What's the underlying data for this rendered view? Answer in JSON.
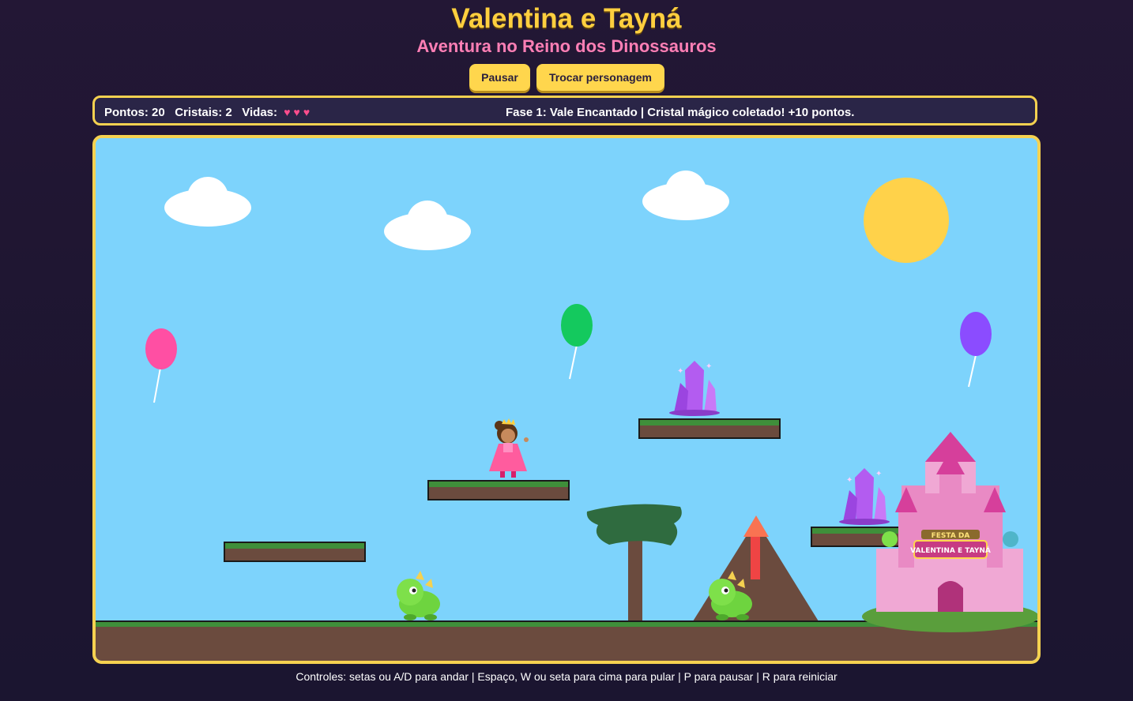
{
  "header": {
    "title": "Valentina e Tayná",
    "subtitle": "Aventura no Reino dos Dinossauros"
  },
  "controls": {
    "pause_label": "Pausar",
    "switch_character_label": "Trocar personagem"
  },
  "hud": {
    "points_label": "Pontos:",
    "points": "20",
    "crystals_label": "Cristais:",
    "crystals": "2",
    "lives_label": "Vidas:",
    "lives_count": 3,
    "status_message": "Fase 1: Vale Encantado | Cristal mágico coletado! +10 pontos."
  },
  "scene": {
    "castle_banner_line1": "FESTA DA",
    "castle_banner_line2": "VALENTINA E TAYNÁ",
    "colors": {
      "sky": "#7dd3fc",
      "ground": "#6b4b3e",
      "grass": "#3f8f3a",
      "sun": "#ffd24a",
      "balloon_pink": "#ff4fa3",
      "balloon_green": "#14c95e",
      "balloon_purple": "#8b4cff",
      "crystal": "#b35cf0"
    }
  },
  "footer": {
    "help_text": "Controles: setas ou A/D para andar | Espaço, W ou seta para cima para pular | P para pausar | R para reiniciar"
  }
}
